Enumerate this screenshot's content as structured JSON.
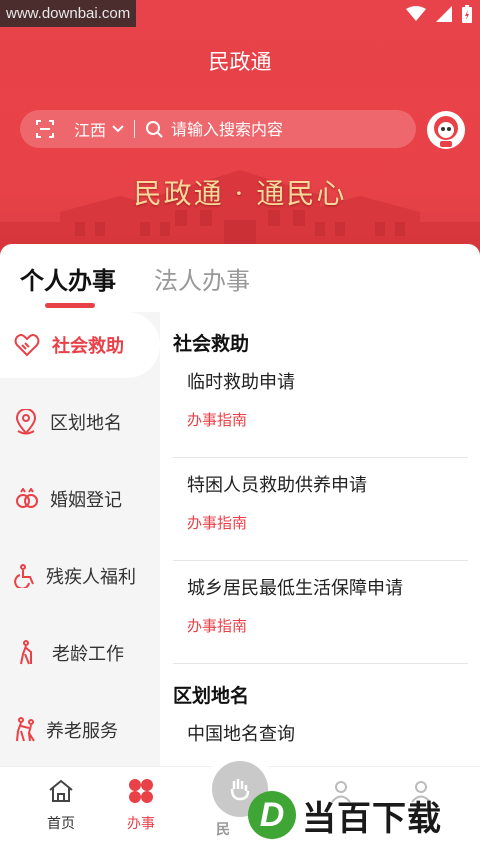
{
  "watermark": "www.downbai.com",
  "app_title": "民政通",
  "search": {
    "region": "江西",
    "placeholder": "请输入搜索内容"
  },
  "banner": {
    "text": "民政通 · 通民心"
  },
  "tabs": [
    {
      "label": "个人办事",
      "active": true
    },
    {
      "label": "法人办事",
      "active": false
    }
  ],
  "sidebar": {
    "items": [
      {
        "label": "社会救助",
        "icon": "handshake-icon",
        "active": true
      },
      {
        "label": "区划地名",
        "icon": "location-pin-icon",
        "active": false
      },
      {
        "label": "婚姻登记",
        "icon": "rings-icon",
        "active": false
      },
      {
        "label": "残疾人福利",
        "icon": "wheelchair-icon",
        "active": false
      },
      {
        "label": "老龄工作",
        "icon": "elderly-cane-icon",
        "active": false
      },
      {
        "label": "养老服务",
        "icon": "elderly-care-icon",
        "active": false
      }
    ]
  },
  "sections": [
    {
      "title": "社会救助",
      "services": [
        {
          "name": "临时救助申请",
          "guide": "办事指南"
        },
        {
          "name": "特困人员救助供养申请",
          "guide": "办事指南"
        },
        {
          "name": "城乡居民最低生活保障申请",
          "guide": "办事指南"
        }
      ]
    },
    {
      "title": "区划地名",
      "services": [
        {
          "name": "中国地名查询"
        }
      ]
    }
  ],
  "bottom_nav": {
    "items": [
      {
        "label": "首页",
        "icon": "home-icon",
        "active": false
      },
      {
        "label": "办事",
        "icon": "clover-grid-icon",
        "active": true
      },
      {
        "label": "民",
        "icon": "hand-service-icon",
        "active": false
      }
    ]
  },
  "logo_watermark": {
    "letter": "D",
    "text": "当百下载"
  },
  "colors": {
    "brand_red": "#e94148",
    "banner_gold": "#f9d89a",
    "logo_green": "#3fa535"
  }
}
